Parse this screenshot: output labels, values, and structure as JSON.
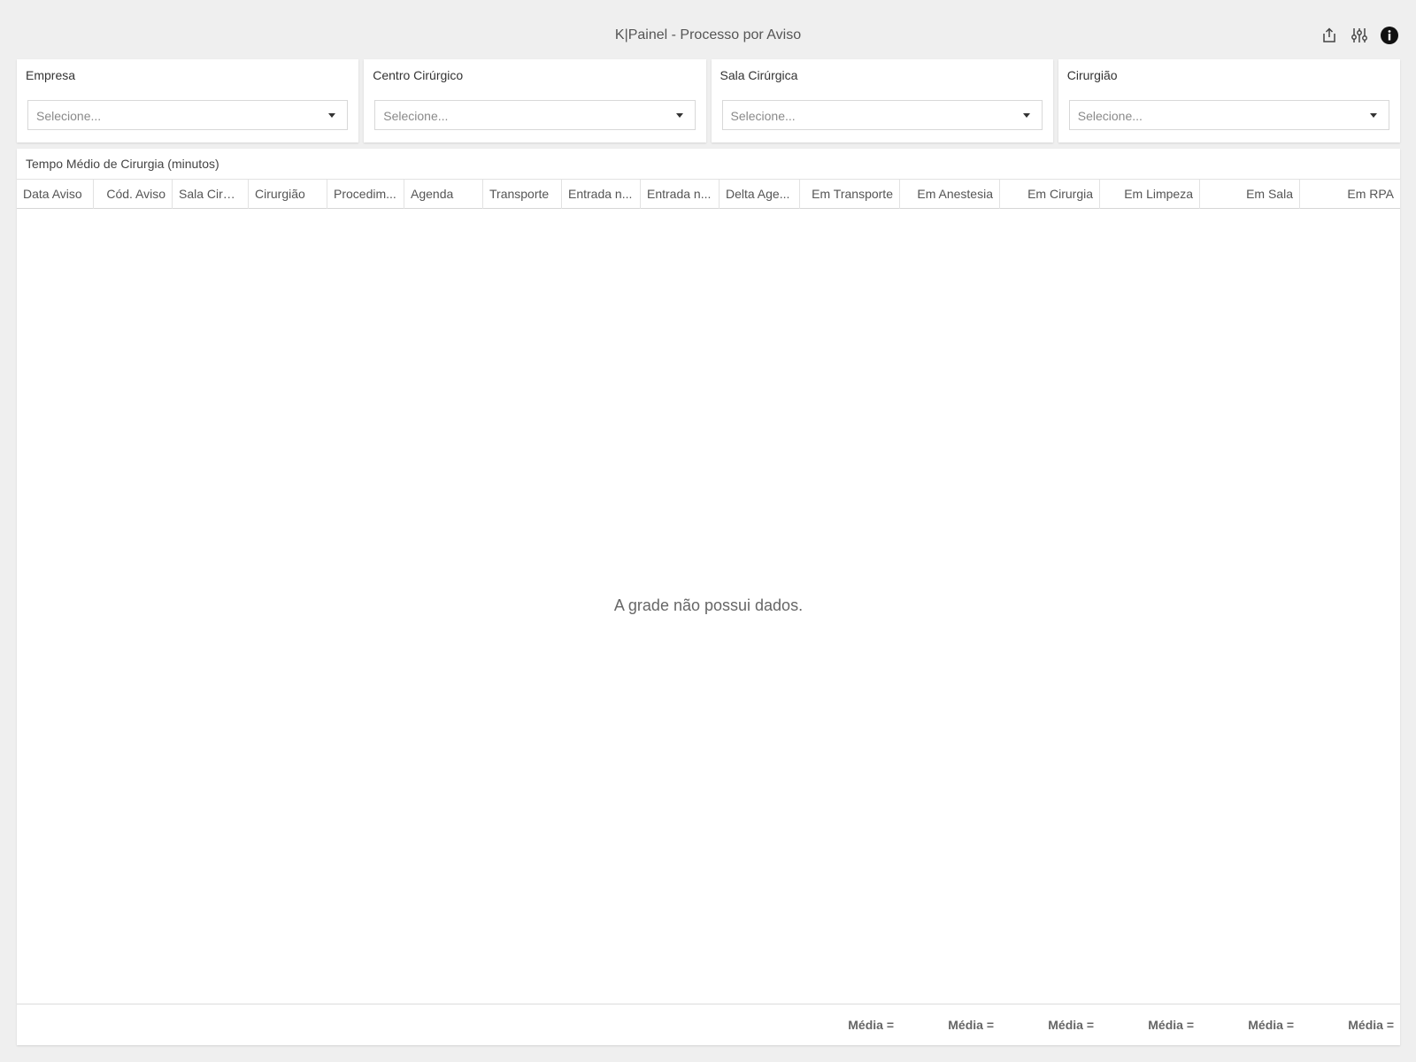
{
  "header": {
    "title": "K|Painel - Processo por Aviso",
    "icons": [
      "export-icon",
      "settings-sliders-icon",
      "info-icon"
    ]
  },
  "filters": [
    {
      "label": "Empresa",
      "placeholder": "Selecione..."
    },
    {
      "label": "Centro Cirúrgico",
      "placeholder": "Selecione..."
    },
    {
      "label": "Sala Cirúrgica",
      "placeholder": "Selecione..."
    },
    {
      "label": "Cirurgião",
      "placeholder": "Selecione..."
    }
  ],
  "grid": {
    "title": "Tempo Médio de Cirurgia (minutos)",
    "columns": [
      "Data Aviso",
      "Cód. Aviso",
      "Sala Cirúr...",
      "Cirurgião",
      "Procedim...",
      "Agenda",
      "Transporte",
      "Entrada n...",
      "Entrada n...",
      "Delta Age...",
      "Em Transporte",
      "Em Anestesia",
      "Em Cirurgia",
      "Em Limpeza",
      "Em Sala",
      "Em RPA"
    ],
    "empty_message": "A grade não possui dados.",
    "footer": [
      "Média =",
      "Média =",
      "Média =",
      "Média =",
      "Média =",
      "Média ="
    ]
  }
}
